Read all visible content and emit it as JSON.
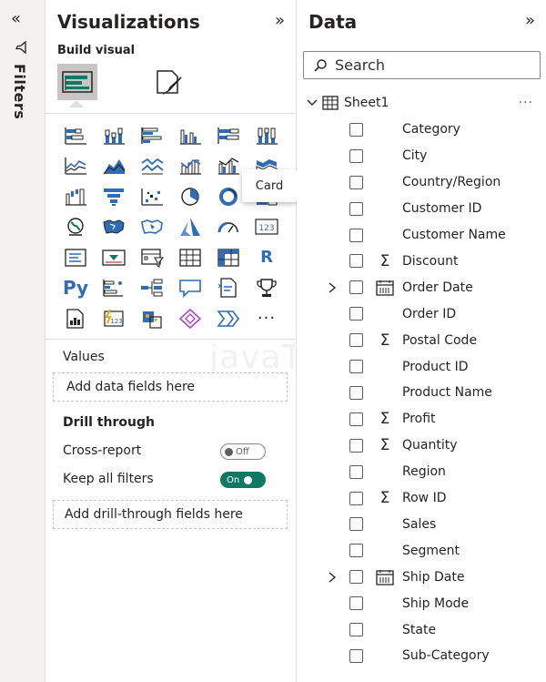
{
  "filters_rail": {
    "label": "Filters",
    "collapse_glyph": "«"
  },
  "visualizations": {
    "title": "Visualizations",
    "expand_glyph": "»",
    "build_visual_label": "Build visual",
    "tooltip": "Card",
    "py_label": "Py",
    "r_label": "R",
    "more_label": "···",
    "values_label": "Values",
    "values_placeholder": "Add data fields here",
    "drill_through_label": "Drill through",
    "cross_report_label": "Cross-report",
    "cross_report_toggle": "Off",
    "keep_filters_label": "Keep all filters",
    "keep_filters_toggle": "On",
    "drill_placeholder": "Add drill-through fields here",
    "watermark": "javaTpoint",
    "accent_color": "#117865",
    "icon_color": "#2f6cb4"
  },
  "data": {
    "title": "Data",
    "expand_glyph": "»",
    "search_placeholder": "Search",
    "table_name": "Sheet1",
    "table_more": "···",
    "fields": [
      {
        "label": "Category",
        "type": "text",
        "expandable": false
      },
      {
        "label": "City",
        "type": "text",
        "expandable": false
      },
      {
        "label": "Country/Region",
        "type": "text",
        "expandable": false
      },
      {
        "label": "Customer ID",
        "type": "text",
        "expandable": false
      },
      {
        "label": "Customer Name",
        "type": "text",
        "expandable": false
      },
      {
        "label": "Discount",
        "type": "sum",
        "expandable": false
      },
      {
        "label": "Order Date",
        "type": "date",
        "expandable": true
      },
      {
        "label": "Order ID",
        "type": "text",
        "expandable": false
      },
      {
        "label": "Postal Code",
        "type": "sum",
        "expandable": false
      },
      {
        "label": "Product ID",
        "type": "text",
        "expandable": false
      },
      {
        "label": "Product Name",
        "type": "text",
        "expandable": false
      },
      {
        "label": "Profit",
        "type": "sum",
        "expandable": false
      },
      {
        "label": "Quantity",
        "type": "sum",
        "expandable": false
      },
      {
        "label": "Region",
        "type": "text",
        "expandable": false
      },
      {
        "label": "Row ID",
        "type": "sum",
        "expandable": false
      },
      {
        "label": "Sales",
        "type": "text",
        "expandable": false
      },
      {
        "label": "Segment",
        "type": "text",
        "expandable": false
      },
      {
        "label": "Ship Date",
        "type": "date",
        "expandable": true
      },
      {
        "label": "Ship Mode",
        "type": "text",
        "expandable": false
      },
      {
        "label": "State",
        "type": "text",
        "expandable": false
      },
      {
        "label": "Sub-Category",
        "type": "text",
        "expandable": false
      }
    ]
  }
}
